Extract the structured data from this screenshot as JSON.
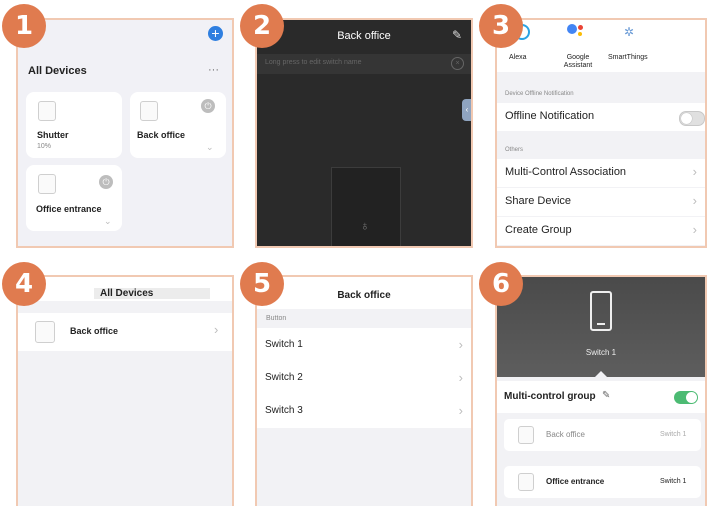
{
  "steps": [
    "1",
    "2",
    "3",
    "4",
    "5",
    "6"
  ],
  "p1": {
    "title": "All Devices",
    "more": "···",
    "add": "+",
    "shutter": {
      "name": "Shutter",
      "value": "10%"
    },
    "back_office": {
      "name": "Back office"
    },
    "office_entrance": {
      "name": "Office entrance"
    }
  },
  "p2": {
    "title": "Back office",
    "hint": "Long press to edit switch name"
  },
  "p3": {
    "assistants": [
      "Alexa",
      "Google Assistant",
      "SmartThings"
    ],
    "offline_header": "Device Offline Notification",
    "offline_label": "Offline Notification",
    "others_header": "Others",
    "items": [
      "Multi-Control Association",
      "Share Device",
      "Create Group"
    ]
  },
  "p4": {
    "title": "All Devices",
    "item": "Back office"
  },
  "p5": {
    "title": "Back office",
    "section": "Button",
    "items": [
      "Switch 1",
      "Switch 2",
      "Switch 3"
    ]
  },
  "p6": {
    "switch_label": "Switch 1",
    "group_title": "Multi-control group",
    "rows": [
      {
        "name": "Back office",
        "switch": "Switch 1"
      },
      {
        "name": "Office entrance",
        "switch": "Switch 1"
      }
    ]
  },
  "colors": {
    "badge": "#e07b4f",
    "border": "#f1c9b2",
    "accent_blue": "#2f7fe0",
    "toggle_on": "#4cbb73"
  }
}
